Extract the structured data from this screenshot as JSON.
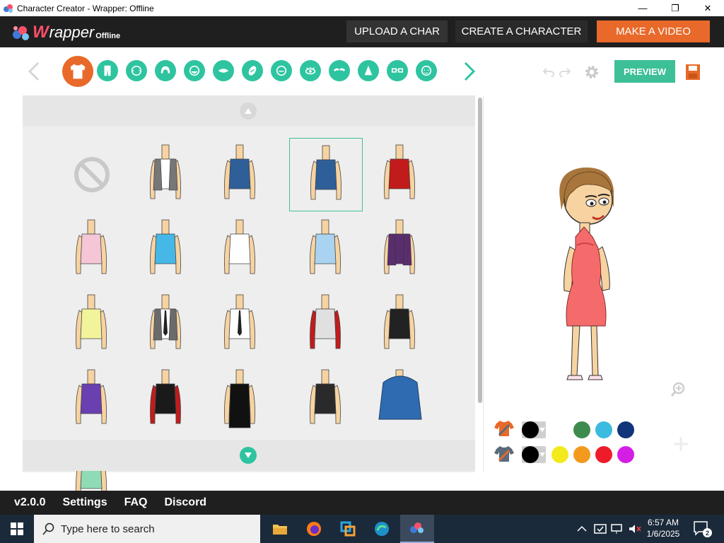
{
  "window": {
    "title": "Character Creator - Wrapper: Offline",
    "minimize_glyph": "—",
    "restore_glyph": "❐",
    "close_glyph": "✕"
  },
  "header": {
    "logo_w": "W",
    "logo_rest": "rapper",
    "logo_sub": "Offline",
    "upload_label": "UPLOAD A CHAR",
    "create_label": "CREATE A CHARACTER",
    "make_label": "MAKE A VIDEO"
  },
  "toolbar": {
    "categories": [
      {
        "name": "tab-tops",
        "icon": "shirt-icon",
        "active": true
      },
      {
        "name": "tab-bottoms",
        "icon": "pants-icon"
      },
      {
        "name": "tab-face-shape",
        "icon": "face-shape-icon"
      },
      {
        "name": "tab-hair",
        "icon": "hair-icon"
      },
      {
        "name": "tab-beard",
        "icon": "beard-icon"
      },
      {
        "name": "tab-mouth",
        "icon": "mouth-icon"
      },
      {
        "name": "tab-accessory",
        "icon": "accessory-icon"
      },
      {
        "name": "tab-head",
        "icon": "head-icon"
      },
      {
        "name": "tab-eyes",
        "icon": "eye-icon"
      },
      {
        "name": "tab-eyebrows",
        "icon": "eyebrow-icon"
      },
      {
        "name": "tab-nose",
        "icon": "nose-icon"
      },
      {
        "name": "tab-glasses",
        "icon": "glasses-icon"
      },
      {
        "name": "tab-face",
        "icon": "face-icon"
      }
    ],
    "preview_label": "PREVIEW",
    "accent_color": "#2ec4a0",
    "active_color": "#e8692a"
  },
  "items": [
    {
      "kind": "none"
    },
    {
      "kind": "top",
      "shirt": "#ffffff",
      "jacket": "#777777"
    },
    {
      "kind": "top",
      "shirt": "#2f5f99"
    },
    {
      "kind": "top",
      "shirt": "#2f5f99",
      "halter": true,
      "selected": true
    },
    {
      "kind": "top",
      "shirt": "#c21b1b",
      "tube": true
    },
    {
      "kind": "top",
      "shirt": "#f4c6d6"
    },
    {
      "kind": "top",
      "shirt": "#45b8e8"
    },
    {
      "kind": "top",
      "shirt": "#ffffff"
    },
    {
      "kind": "top",
      "shirt": "#a9d3f0"
    },
    {
      "kind": "top",
      "shirt": "#5a2e6e",
      "jacket": "#5a2e6e"
    },
    {
      "kind": "top",
      "shirt": "#f2f49c"
    },
    {
      "kind": "top",
      "shirt": "#ffffff",
      "jacket": "#6b6b6b",
      "tie": true
    },
    {
      "kind": "top",
      "shirt": "#ffffff",
      "tie": true
    },
    {
      "kind": "top",
      "shirt": "#e0e0e0",
      "arms_red": true
    },
    {
      "kind": "top",
      "shirt": "#222222"
    },
    {
      "kind": "top",
      "shirt": "#6a3fb0"
    },
    {
      "kind": "top",
      "shirt": "#1a1a1a",
      "arms_red": true
    },
    {
      "kind": "top",
      "shirt": "#111111",
      "dress": true
    },
    {
      "kind": "top",
      "shirt": "#2a2a2a"
    },
    {
      "kind": "top",
      "shirt": "#2f6bb0",
      "hoodie": true
    },
    {
      "kind": "top",
      "shirt": "#8fdbb5"
    }
  ],
  "colors": {
    "row1_dd": "#000000",
    "row1": [
      "#ffffff",
      "#3e8b4f",
      "#3cbbe0",
      "#10357a"
    ],
    "row2_dd": "#000000",
    "row2": [
      "#f2ea1d",
      "#f39a1e",
      "#ee1c2a",
      "#d41ee6"
    ]
  },
  "footer": {
    "version": "v2.0.0",
    "settings": "Settings",
    "faq": "FAQ",
    "discord": "Discord"
  },
  "taskbar": {
    "search_placeholder": "Type here to search",
    "time": "6:57 AM",
    "date": "1/6/2025",
    "notif_count": "2"
  }
}
